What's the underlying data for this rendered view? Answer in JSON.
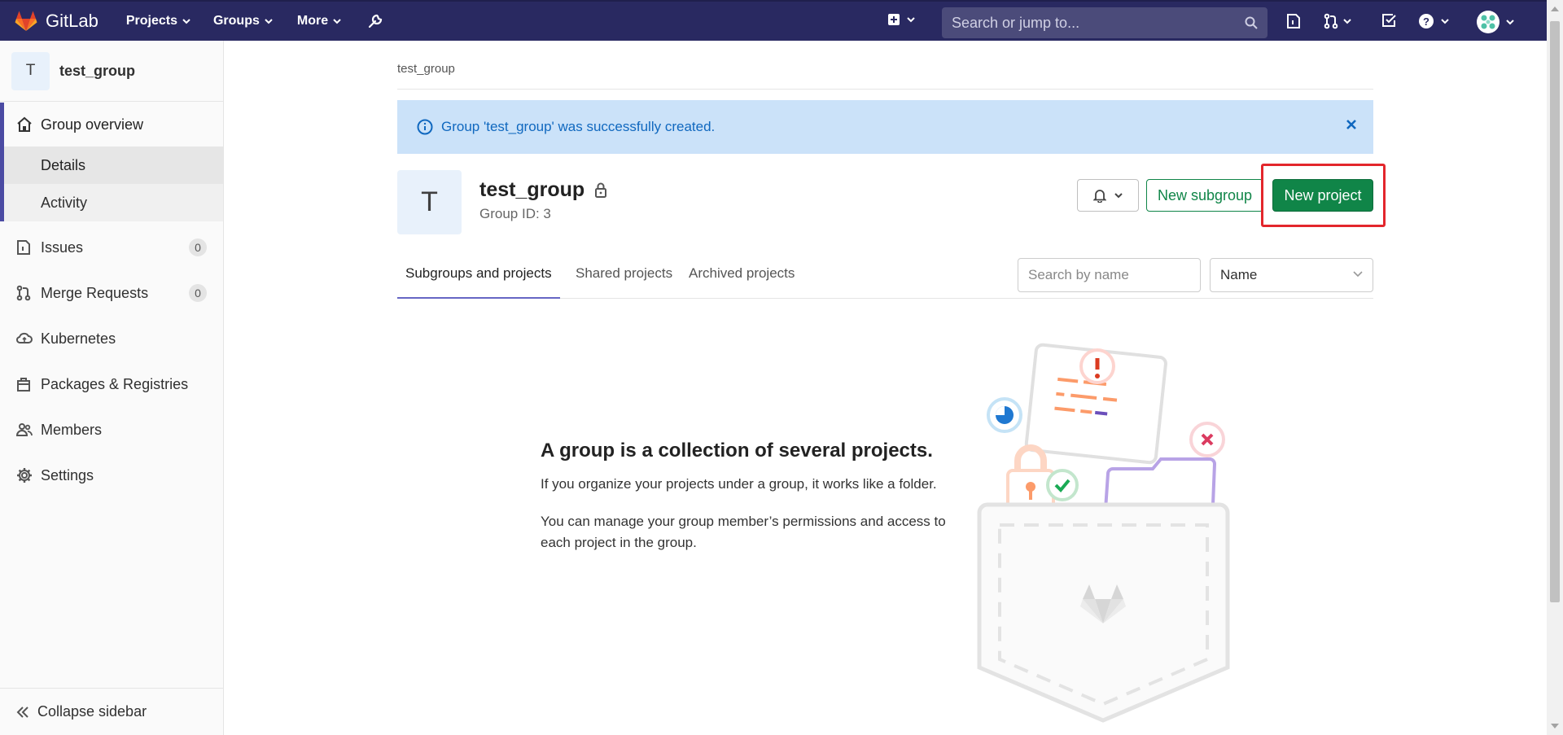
{
  "topbar": {
    "brand": "GitLab",
    "nav": [
      "Projects",
      "Groups",
      "More"
    ],
    "search_placeholder": "Search or jump to..."
  },
  "sidebar": {
    "context_initial": "T",
    "context_name": "test_group",
    "overview_label": "Group overview",
    "sub_items": [
      "Details",
      "Activity"
    ],
    "items": [
      {
        "label": "Issues",
        "icon": "issues-icon",
        "count": "0"
      },
      {
        "label": "Merge Requests",
        "icon": "merge-request-icon",
        "count": "0"
      },
      {
        "label": "Kubernetes",
        "icon": "kubernetes-icon"
      },
      {
        "label": "Packages & Registries",
        "icon": "package-icon"
      },
      {
        "label": "Members",
        "icon": "members-icon"
      },
      {
        "label": "Settings",
        "icon": "settings-icon"
      }
    ],
    "collapse_label": "Collapse sidebar"
  },
  "main": {
    "breadcrumb": "test_group",
    "alert": "Group 'test_group' was successfully created.",
    "group": {
      "initial": "T",
      "name": "test_group",
      "id_label": "Group ID: 3"
    },
    "buttons": {
      "new_subgroup": "New subgroup",
      "new_project": "New project"
    },
    "tabs": [
      "Subgroups and projects",
      "Shared projects",
      "Archived projects"
    ],
    "filter_placeholder": "Search by name",
    "sort_value": "Name",
    "empty_state": {
      "title": "A group is a collection of several projects.",
      "p1": "If you organize your projects under a group, it works like a folder.",
      "p2": "You can manage your group member’s permissions and access to each project in the group."
    }
  },
  "colors": {
    "topbar": "#292961",
    "primary_green": "#108548",
    "alert_bg": "#cbe2f9",
    "highlight_box": "#e3262c"
  }
}
